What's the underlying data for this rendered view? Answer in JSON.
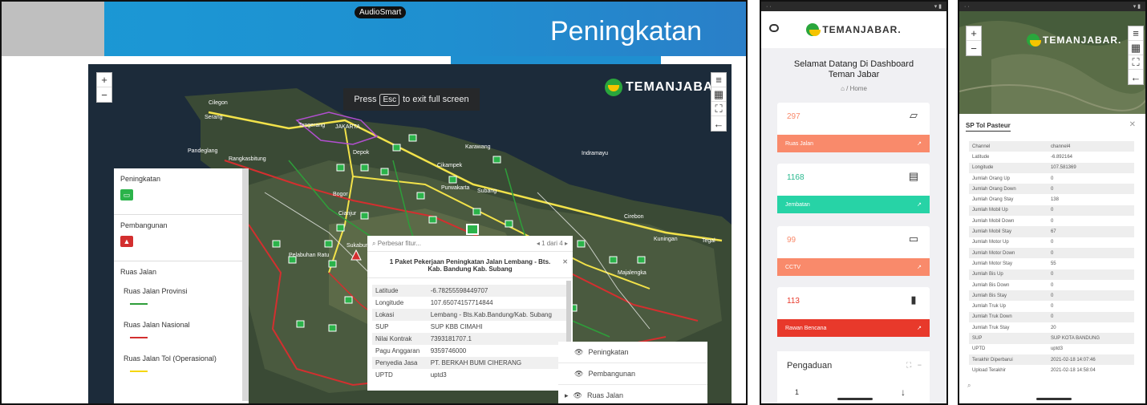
{
  "slide": {
    "title": "Peningkatan",
    "audio_badge": "AudioSmart"
  },
  "map_ui": {
    "zoom_in": "+",
    "zoom_out": "−",
    "brand": "TEMANJABAR.",
    "fullscreen_note": {
      "press": "Press",
      "key": "Esc",
      "suffix": "to exit full screen"
    },
    "toolbar_icons": [
      "list-icon",
      "map-icon",
      "fullscreen-icon",
      "back-arrow-icon"
    ]
  },
  "map_labels": [
    "Serang",
    "Tangerang",
    "JAKARTA",
    "Pandeglang",
    "Rangkasbitung",
    "Cikampek",
    "Indramayu",
    "Purwakarta",
    "Subang",
    "Bogor",
    "Cianjur",
    "Cirebon",
    "Kuningan",
    "Tegal",
    "Sukabumi",
    "Pelabuhan Ratu",
    "Majalengka",
    "Cilegon",
    "Depok",
    "Karawang"
  ],
  "legend": {
    "section1": "Peningkatan",
    "section2": "Pembangunan",
    "section3": "Ruas Jalan",
    "roads": [
      {
        "label": "Ruas Jalan Provinsi",
        "color": "#2e9e3a"
      },
      {
        "label": "Ruas Jalan Nasional",
        "color": "#d32f2f"
      },
      {
        "label": "Ruas Jalan Tol (Operasional)",
        "color": "#f5d60a"
      }
    ]
  },
  "popup": {
    "search_placeholder": "Perbesar fitur...",
    "pager": "1 dari 4",
    "title": "1 Paket Pekerjaan Peningkatan Jalan Lembang - Bts. Kab. Bandung Kab. Subang",
    "rows": [
      {
        "k": "Latitude",
        "v": "-6.78255598449707"
      },
      {
        "k": "Longitude",
        "v": "107.65074157714844"
      },
      {
        "k": "Lokasi",
        "v": "Lembang - Bts.Kab.Bandung/Kab. Subang"
      },
      {
        "k": "SUP",
        "v": "SUP KBB CIMAHI"
      },
      {
        "k": "Nilai Kontrak",
        "v": "7393181707.1"
      },
      {
        "k": "Pagu Anggaran",
        "v": "9359746000"
      },
      {
        "k": "Penyedia Jasa",
        "v": "PT. BERKAH BUMI CIHERANG"
      },
      {
        "k": "UPTD",
        "v": "uptd3"
      }
    ]
  },
  "layers": [
    "Peningkatan",
    "Pembangunan",
    "Ruas Jalan"
  ],
  "dashboard": {
    "brand": "TEMANJABAR.",
    "welcome_line1": "Selamat Datang Di Dashboard",
    "welcome_line2": "Teman Jabar",
    "crumb": "Home",
    "cards": [
      {
        "value": "297",
        "label": "Ruas Jalan",
        "color": "#f98a6b",
        "icon": "map-icon"
      },
      {
        "value": "1168",
        "label": "Jembatan",
        "color": "#27d3a6",
        "icon": "document-icon"
      },
      {
        "value": "99",
        "label": "CCTV",
        "color": "#f98a6b",
        "icon": "video-icon"
      },
      {
        "value": "113",
        "label": "Rawan Bencana",
        "color": "#e8392b",
        "icon": "bar-chart-icon"
      }
    ],
    "pengaduan_title": "Pengaduan",
    "pengaduan_first": "1"
  },
  "detail": {
    "brand": "TEMANJABAR.",
    "title": "SP Tol Pasteur",
    "rows": [
      {
        "k": "Channel",
        "v": "channel4"
      },
      {
        "k": "Latitude",
        "v": "-6.892164"
      },
      {
        "k": "Longitude",
        "v": "107.581369"
      },
      {
        "k": "Jumlah Orang Up",
        "v": "0"
      },
      {
        "k": "Jumlah Orang Down",
        "v": "0"
      },
      {
        "k": "Jumlah Orang Stay",
        "v": "138"
      },
      {
        "k": "Jumlah Mobil Up",
        "v": "0"
      },
      {
        "k": "Jumlah Mobil Down",
        "v": "0"
      },
      {
        "k": "Jumlah Mobil Stay",
        "v": "67"
      },
      {
        "k": "Jumlah Motor Up",
        "v": "0"
      },
      {
        "k": "Jumlah Motor Down",
        "v": "0"
      },
      {
        "k": "Jumlah Motor Stay",
        "v": "55"
      },
      {
        "k": "Jumlah Bis Up",
        "v": "0"
      },
      {
        "k": "Jumlah Bis Down",
        "v": "0"
      },
      {
        "k": "Jumlah Bis Stay",
        "v": "0"
      },
      {
        "k": "Jumlah Truk Up",
        "v": "0"
      },
      {
        "k": "Jumlah Truk Down",
        "v": "0"
      },
      {
        "k": "Jumlah Truk Stay",
        "v": "20"
      },
      {
        "k": "SUP",
        "v": "SUP KOTA BANDUNG"
      },
      {
        "k": "UPTD",
        "v": "uptd3"
      },
      {
        "k": "Terakhir Diperbarui",
        "v": "2021-02-18 14:07:46"
      },
      {
        "k": "Upload Terakhir",
        "v": "2021-02-18 14:58:04"
      }
    ]
  }
}
